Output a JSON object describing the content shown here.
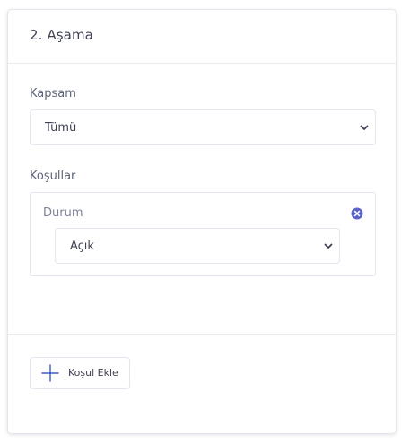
{
  "stage": {
    "title": "2. Aşama"
  },
  "scope": {
    "label": "Kapsam",
    "selected": "Tümü"
  },
  "conditions": {
    "label": "Koşullar",
    "items": [
      {
        "label": "Durum",
        "selected": "Açık"
      }
    ]
  },
  "footer": {
    "add_condition_label": "Koşul Ekle"
  },
  "colors": {
    "remove_icon": "#5a63c8",
    "plus_icon": "#3f5bbf"
  }
}
